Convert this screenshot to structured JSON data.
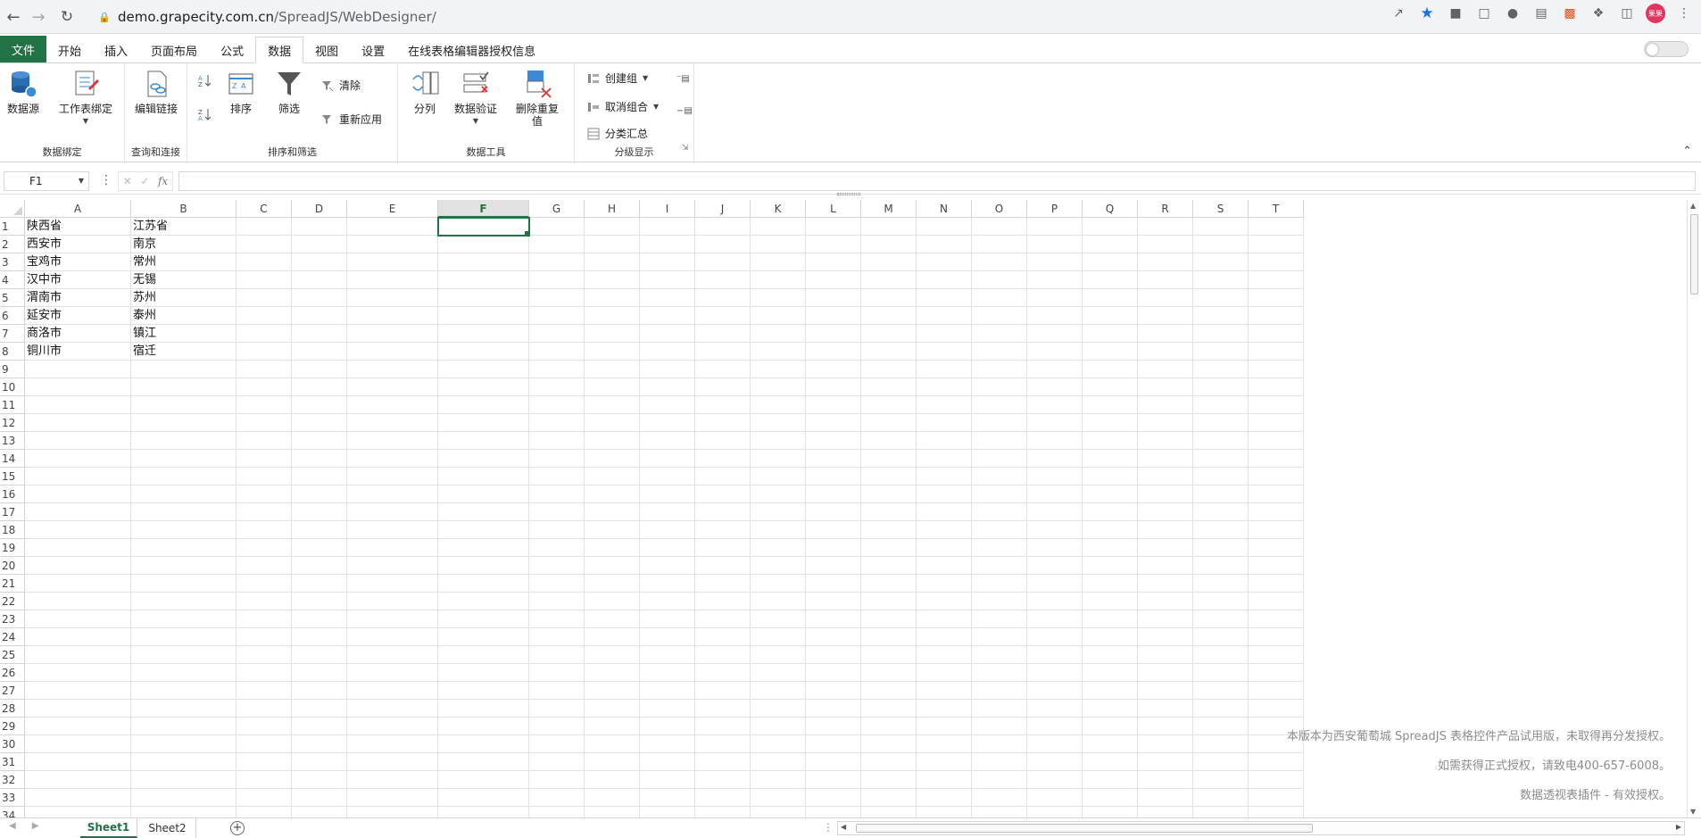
{
  "browser": {
    "url_host": "demo.grapecity.com.cn",
    "url_path": "/SpreadJS/WebDesigner/",
    "avatar_text": "果果"
  },
  "ribbon_tabs": [
    {
      "label": "文件"
    },
    {
      "label": "开始"
    },
    {
      "label": "插入"
    },
    {
      "label": "页面布局"
    },
    {
      "label": "公式"
    },
    {
      "label": "数据"
    },
    {
      "label": "视图"
    },
    {
      "label": "设置"
    },
    {
      "label": "在线表格编辑器授权信息"
    }
  ],
  "ribbon": {
    "data_binding": {
      "label": "数据绑定",
      "datasource": "数据源",
      "sheet_binding": "工作表绑定"
    },
    "query": {
      "label": "查询和连接",
      "edit_links": "编辑链接"
    },
    "sort_filter": {
      "label": "排序和筛选",
      "sort": "排序",
      "filter": "筛选",
      "clear": "清除",
      "reapply": "重新应用"
    },
    "data_tools": {
      "label": "数据工具",
      "split": "分列",
      "validation": "数据验证",
      "remove_dup_1": "删除重复",
      "remove_dup_2": "值"
    },
    "outline": {
      "label": "分级显示",
      "group": "创建组",
      "ungroup": "取消组合",
      "subtotal": "分类汇总"
    }
  },
  "formula_bar": {
    "name_box": "F1",
    "fx": "fx",
    "formula": ""
  },
  "columns": [
    "A",
    "B",
    "C",
    "D",
    "E",
    "F",
    "G",
    "H",
    "I",
    "J",
    "K",
    "L",
    "M",
    "N",
    "O",
    "P",
    "Q",
    "R",
    "S",
    "T"
  ],
  "selected_column": "F",
  "rows": [
    [
      "陕西省",
      "江苏省"
    ],
    [
      "西安市",
      "南京"
    ],
    [
      "宝鸡市",
      "常州"
    ],
    [
      "汉中市",
      "无锡"
    ],
    [
      "渭南市",
      "苏州"
    ],
    [
      "延安市",
      "泰州"
    ],
    [
      "商洛市",
      "镇江"
    ],
    [
      "铜川市",
      "宿迁"
    ]
  ],
  "row_count": 34,
  "watermark": [
    "本版本为西安葡萄城 SpreadJS 表格控件产品试用版，未取得再分发授权。",
    "如需获得正式授权，请致电400-657-6008。",
    "数据透视表插件 - 有效授权。"
  ],
  "sheets": [
    {
      "label": "Sheet1",
      "active": true
    },
    {
      "label": "Sheet2",
      "active": false
    }
  ],
  "colors": {
    "accent": "#217346"
  }
}
